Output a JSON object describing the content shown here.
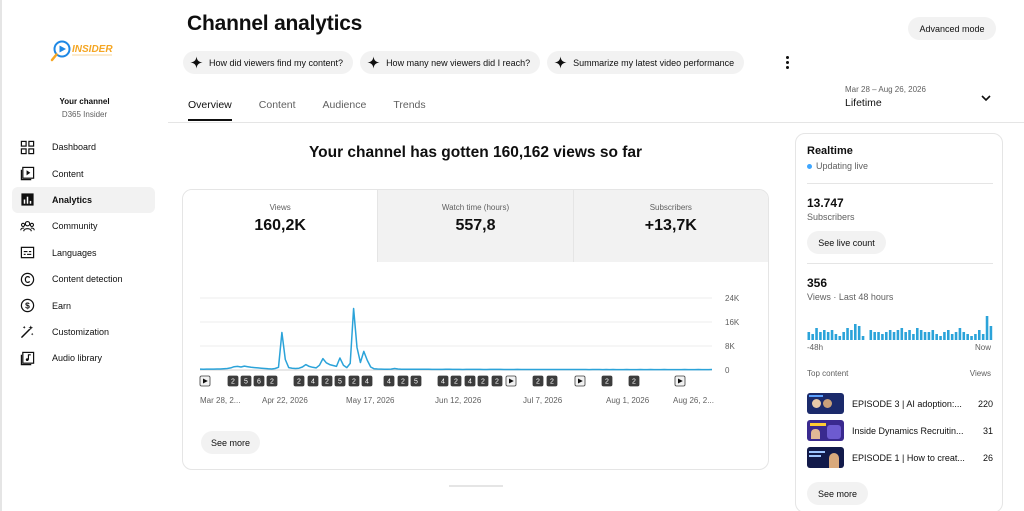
{
  "sidebar": {
    "logo_text": "INSIDER",
    "channel_label": "Your channel",
    "channel_name": "D365 Insider",
    "items": [
      {
        "label": "Dashboard",
        "icon": "dashboard-icon"
      },
      {
        "label": "Content",
        "icon": "content-icon"
      },
      {
        "label": "Analytics",
        "icon": "analytics-icon",
        "active": true
      },
      {
        "label": "Community",
        "icon": "community-icon"
      },
      {
        "label": "Languages",
        "icon": "languages-icon"
      },
      {
        "label": "Content detection",
        "icon": "copyright-icon"
      },
      {
        "label": "Earn",
        "icon": "earn-icon"
      },
      {
        "label": "Customization",
        "icon": "customization-icon"
      },
      {
        "label": "Audio library",
        "icon": "audio-library-icon"
      }
    ]
  },
  "header": {
    "title": "Channel analytics",
    "advanced_button": "Advanced mode",
    "chips": [
      "How did viewers find my content?",
      "How many new viewers did I reach?",
      "Summarize my latest video performance"
    ],
    "tabs": [
      "Overview",
      "Content",
      "Audience",
      "Trends"
    ],
    "active_tab": "Overview",
    "date_range": "Mar 28 – Aug 26, 2026",
    "date_label": "Lifetime"
  },
  "main": {
    "headline": "Your channel has gotten 160,162 views so far",
    "metrics": [
      {
        "label": "Views",
        "value": "160,2K"
      },
      {
        "label": "Watch time (hours)",
        "value": "557,8"
      },
      {
        "label": "Subscribers",
        "value": "+13,7K"
      }
    ],
    "see_more": "See more"
  },
  "chart_data": {
    "type": "line",
    "series": [
      {
        "values": [
          300,
          280,
          310,
          290,
          300,
          320,
          350,
          420,
          500,
          700,
          1100,
          1200,
          1000,
          1300,
          1100,
          900,
          800,
          700,
          600,
          500,
          400,
          350,
          500,
          900,
          12500,
          3500,
          800,
          600,
          500,
          600,
          1000,
          1800,
          1200,
          900,
          700,
          1600,
          3800,
          2400,
          1800,
          1500,
          1200,
          4000,
          1600,
          800,
          2200,
          20500,
          7500,
          2500,
          6200,
          3200,
          1000,
          400,
          350,
          300,
          280,
          260,
          300,
          500,
          350,
          280,
          260,
          250,
          240,
          230,
          220,
          230,
          240,
          220,
          210,
          200,
          200,
          210,
          220,
          230,
          210,
          200,
          190,
          180,
          190,
          200,
          210,
          200,
          190,
          180,
          180,
          190,
          200,
          200,
          190,
          180,
          170,
          170,
          180,
          190,
          180,
          170,
          160,
          170,
          180,
          170,
          160,
          150,
          160,
          170,
          160,
          150,
          150,
          160,
          170,
          160,
          150,
          150,
          160,
          150,
          140,
          150,
          160,
          150,
          140,
          150,
          140,
          150,
          140,
          130,
          140,
          150,
          140,
          130,
          140,
          150,
          140,
          140,
          150,
          140,
          130,
          140,
          150,
          140,
          130,
          140,
          130,
          140,
          150,
          140,
          130,
          140,
          150,
          140,
          130,
          140,
          150
        ]
      }
    ],
    "x_tick_labels": [
      "Mar 28, 2...",
      "Apr 22, 2026",
      "May 17, 2026",
      "Jun 12, 2026",
      "Jul 7, 2026",
      "Aug 1, 2026",
      "Aug 26, 2..."
    ],
    "y_tick_labels": [
      "24K",
      "16K",
      "8K",
      "0"
    ],
    "y_ticks": [
      24000,
      16000,
      8000,
      0
    ],
    "ylim": [
      0,
      24000
    ],
    "markers": [
      "▶",
      "2",
      "5",
      "6",
      "2",
      "2",
      "4",
      "2",
      "5",
      "2",
      "4",
      "4",
      "2",
      "5",
      "4",
      "2",
      "4",
      "2",
      "2",
      "▶",
      "2",
      "2",
      "▶",
      "2",
      "2",
      "▶"
    ],
    "grid": true,
    "color": "#2ba3d9"
  },
  "realtime": {
    "title": "Realtime",
    "status": "Updating live",
    "subscribers_value": "13.747",
    "subscribers_label": "Subscribers",
    "live_count_button": "See live count",
    "views_value": "356",
    "views_label": "Views · Last 48 hours",
    "bars": [
      4,
      3,
      6,
      4,
      5,
      4,
      5,
      3,
      2,
      4,
      6,
      5,
      8,
      7,
      2,
      0,
      5,
      4,
      4,
      3,
      4,
      5,
      4,
      5,
      6,
      4,
      5,
      3,
      6,
      5,
      4,
      4,
      5,
      3,
      2,
      4,
      5,
      3,
      4,
      6,
      4,
      3,
      2,
      3,
      5,
      3,
      12,
      7
    ],
    "axis_left": "-48h",
    "axis_right": "Now",
    "top_content_label": "Top content",
    "top_views_label": "Views",
    "top_content": [
      {
        "title": "EPISODE 3 | AI adoption:...",
        "views": "220"
      },
      {
        "title": "Inside Dynamics Recruitin...",
        "views": "31"
      },
      {
        "title": "EPISODE 1 | How to creat...",
        "views": "26"
      }
    ],
    "see_more": "See more"
  }
}
